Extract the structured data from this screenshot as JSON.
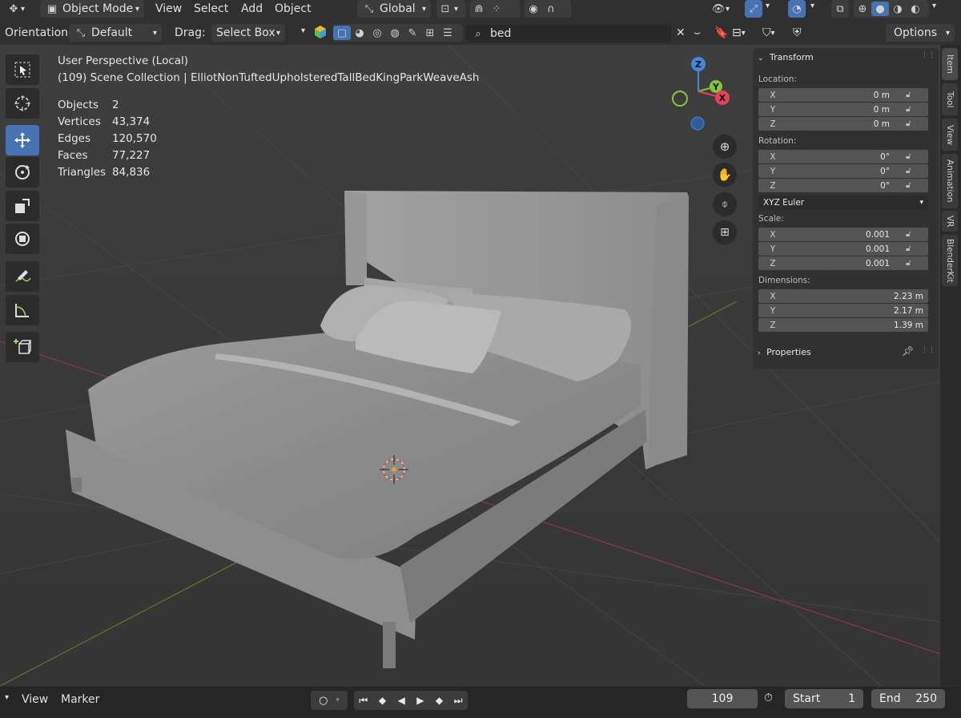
{
  "header": {
    "mode": "Object Mode",
    "menus": [
      "View",
      "Select",
      "Add",
      "Object"
    ],
    "transform_orientation": "Global",
    "options_label": "Options"
  },
  "tool_settings": {
    "orientation_label": "Orientation:",
    "orientation_value": "Default",
    "drag_label": "Drag:",
    "drag_value": "Select Box",
    "search_value": "bed"
  },
  "viewport": {
    "title": "User Perspective (Local)",
    "collection": "(109) Scene Collection | ElliotNonTuftedUpholsteredTallBedKingParkWeaveAsh",
    "stats": [
      {
        "label": "Objects",
        "value": "2"
      },
      {
        "label": "Vertices",
        "value": "43,374"
      },
      {
        "label": "Edges",
        "value": "120,570"
      },
      {
        "label": "Faces",
        "value": "77,227"
      },
      {
        "label": "Triangles",
        "value": "84,836"
      }
    ],
    "gizmo_labels": {
      "z": "Z",
      "y": "Y",
      "x": "X"
    }
  },
  "toolbar": {
    "tools": [
      "select-box-icon",
      "cursor-icon",
      "move-icon",
      "rotate-icon",
      "scale-icon",
      "transform-icon",
      "annotate-icon",
      "measure-icon",
      "add-cube-icon"
    ]
  },
  "n_panel": {
    "section": "Transform",
    "location_label": "Location:",
    "location": [
      {
        "axis": "X",
        "value": "0 m"
      },
      {
        "axis": "Y",
        "value": "0 m"
      },
      {
        "axis": "Z",
        "value": "0 m"
      }
    ],
    "rotation_label": "Rotation:",
    "rotation": [
      {
        "axis": "X",
        "value": "0°"
      },
      {
        "axis": "Y",
        "value": "0°"
      },
      {
        "axis": "Z",
        "value": "0°"
      }
    ],
    "rotation_mode": "XYZ Euler",
    "scale_label": "Scale:",
    "scale": [
      {
        "axis": "X",
        "value": "0.001"
      },
      {
        "axis": "Y",
        "value": "0.001"
      },
      {
        "axis": "Z",
        "value": "0.001"
      }
    ],
    "dimensions_label": "Dimensions:",
    "dimensions": [
      {
        "axis": "X",
        "value": "2.23 m"
      },
      {
        "axis": "Y",
        "value": "2.17 m"
      },
      {
        "axis": "Z",
        "value": "1.39 m"
      }
    ],
    "properties": "Properties",
    "tabs": [
      "Item",
      "Tool",
      "View",
      "Animation",
      "VR",
      "BlenderKit"
    ]
  },
  "timeline": {
    "menus": [
      "View",
      "Marker"
    ],
    "current_frame": "109",
    "start_label": "Start",
    "start_value": "1",
    "end_label": "End",
    "end_value": "250"
  },
  "colors": {
    "accent": "#4772b3",
    "axis_x": "#e3435a",
    "axis_y": "#8ac23c",
    "axis_z": "#3f87e0"
  }
}
